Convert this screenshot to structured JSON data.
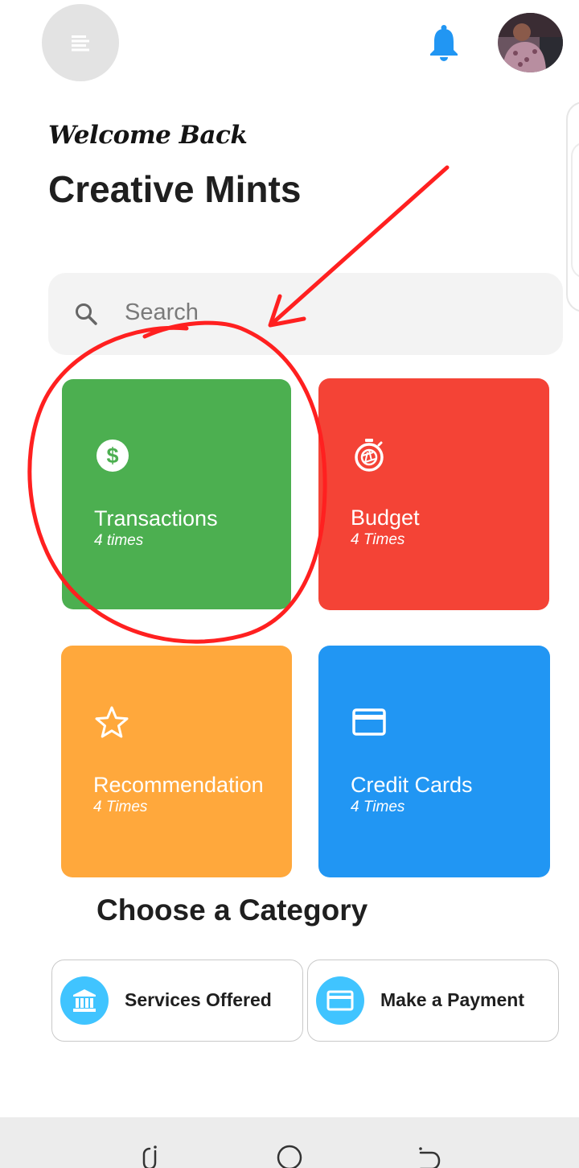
{
  "header": {
    "menu_icon": "menu-lines-icon",
    "notification_icon": "bell-icon",
    "accent_color": "#2196f3",
    "avatar": "user-avatar-photo"
  },
  "greeting": {
    "welcome": "Welcome Back",
    "name": "Creative Mints"
  },
  "search": {
    "placeholder": "Search",
    "icon": "search-icon"
  },
  "tiles": [
    {
      "title": "Transactions",
      "subtitle": "4 times",
      "icon": "dollar-icon",
      "color": "#4caf50"
    },
    {
      "title": "Budget",
      "subtitle": "4 Times",
      "icon": "stopwatch-icon",
      "color": "#f44336"
    },
    {
      "title": "Recommendation",
      "subtitle": "4 Times",
      "icon": "star-icon",
      "color": "#ffa83c"
    },
    {
      "title": "Credit Cards",
      "subtitle": "4 Times",
      "icon": "credit-card-icon",
      "color": "#2196f3"
    }
  ],
  "categories": {
    "title": "Choose a Category",
    "items": [
      {
        "label": "Services Offered",
        "icon": "bank-icon"
      },
      {
        "label": "Make a Payment",
        "icon": "credit-card-icon"
      }
    ],
    "icon_color": "#40c4ff"
  },
  "annotation": {
    "color": "#ff2020",
    "shapes": [
      "arrow",
      "circle"
    ]
  },
  "system_nav": {
    "buttons": [
      "recents-icon",
      "home-icon",
      "back-icon"
    ]
  }
}
